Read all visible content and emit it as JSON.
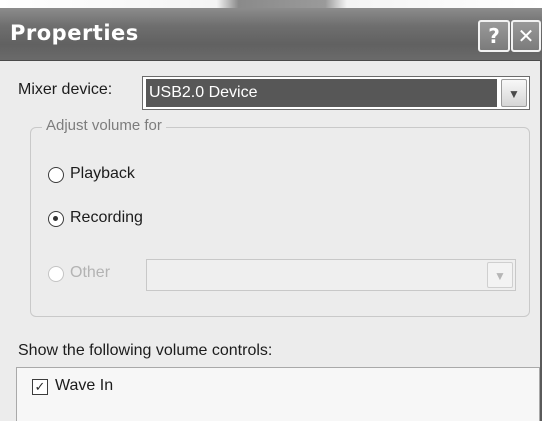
{
  "window": {
    "title": "Properties",
    "help_glyph": "?",
    "close_glyph": "✕"
  },
  "mixer": {
    "label": "Mixer device:",
    "selected": "USB2.0 Device",
    "arrow_glyph": "▼"
  },
  "adjust_group": {
    "legend": "Adjust volume for",
    "options": [
      {
        "label": "Playback",
        "selected": false,
        "enabled": true
      },
      {
        "label": "Recording",
        "selected": true,
        "enabled": true
      },
      {
        "label": "Other",
        "selected": false,
        "enabled": false
      }
    ],
    "other_select_value": "",
    "arrow_glyph": "▼"
  },
  "controls": {
    "label": "Show the following volume controls:",
    "items": [
      {
        "label": "Wave In",
        "checked": true,
        "check_glyph": "✓"
      }
    ]
  }
}
